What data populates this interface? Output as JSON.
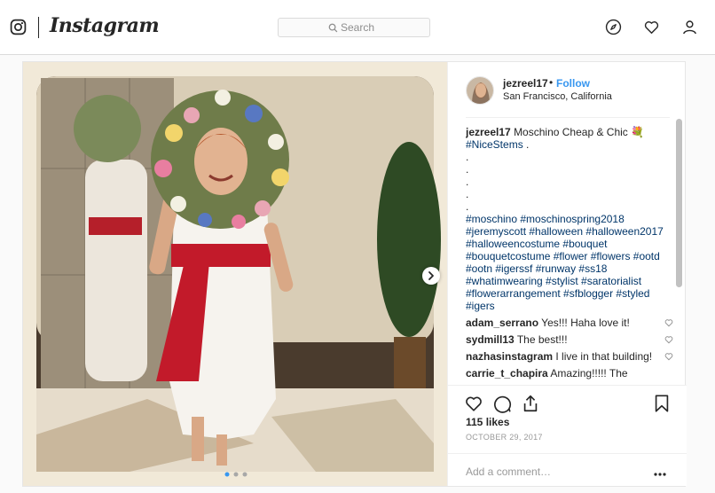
{
  "nav": {
    "brand": "Instagram",
    "search_placeholder": "Search"
  },
  "post": {
    "username": "jezreel17",
    "dot": "•",
    "follow_label": "Follow",
    "location": "San Francisco, California",
    "caption": {
      "author": "jezreel17",
      "text": "Moschino Cheap & Chic 💐",
      "first_tag": "#NiceStems",
      "first_tag_suffix": " .",
      "dots": [
        ".",
        ".",
        ".",
        ".",
        "."
      ],
      "hashtags": "#moschino #moschinospring2018 #jeremyscott #halloween #halloween2017 #halloweencostume #bouquet #bouquetcostume #flower #flowers #ootd #ootn #igerssf #runway #ss18 #whatimwearing #stylist #saratorialist #flowerarrangement #sfblogger #styled #igers"
    },
    "comments": [
      {
        "user": "adam_serrano",
        "text": "Yes!!! Haha love it!"
      },
      {
        "user": "sydmill13",
        "text": "The best!!!"
      },
      {
        "user": "nazhasinstagram",
        "text": "I live in that building!"
      },
      {
        "user": "carrie_t_chapira",
        "text": "Amazing!!!!! The"
      }
    ],
    "likes": "115 likes",
    "date": "OCTOBER 29, 2017",
    "add_comment_placeholder": "Add a comment…",
    "carousel": {
      "count": 3,
      "current": 1
    }
  },
  "colors": {
    "link": "#3897f0",
    "hashtag": "#003569",
    "border": "#dbdbdb"
  },
  "icons": [
    "instagram-glyph-icon",
    "search-icon",
    "explore-compass-icon",
    "activity-heart-icon",
    "profile-person-icon",
    "like-heart-icon",
    "comment-bubble-icon",
    "share-icon",
    "save-bookmark-icon",
    "more-options-icon",
    "next-arrow-icon"
  ]
}
